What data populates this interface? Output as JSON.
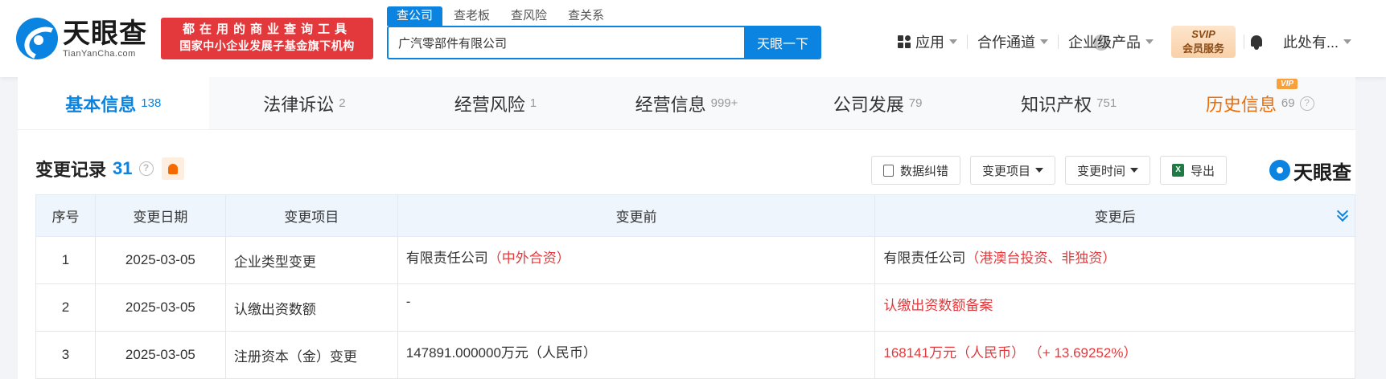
{
  "header": {
    "logo_cn": "天眼查",
    "logo_en": "TianYanCha.com",
    "slogan_line1": "都在用的商业查询工具",
    "slogan_line2": "国家中小企业发展子基金旗下机构",
    "search_tabs": [
      "查公司",
      "查老板",
      "查风险",
      "查关系"
    ],
    "search_value": "广汽零部件有限公司",
    "search_button": "天眼一下",
    "clear_icon": "⊗",
    "nav": [
      "应用",
      "合作通道",
      "企业级产品"
    ],
    "svip_line1": "SVIP",
    "svip_line2": "会员服务",
    "user": "此处有..."
  },
  "tabs": [
    {
      "label": "基本信息",
      "count": "138"
    },
    {
      "label": "法律诉讼",
      "count": "2"
    },
    {
      "label": "经营风险",
      "count": "1"
    },
    {
      "label": "经营信息",
      "count": "999+"
    },
    {
      "label": "公司发展",
      "count": "79"
    },
    {
      "label": "知识产权",
      "count": "751"
    },
    {
      "label": "历史信息",
      "count": "69",
      "badge": "VIP"
    }
  ],
  "section": {
    "title": "变更记录",
    "count": "31",
    "help": "?",
    "toolbar": {
      "correct": "数据纠错",
      "change_item": "变更项目",
      "change_time": "变更时间",
      "export": "导出"
    },
    "brand": "天眼查"
  },
  "table": {
    "headers": [
      "序号",
      "变更日期",
      "变更项目",
      "变更前",
      "变更后"
    ],
    "rows": [
      {
        "no": "1",
        "date": "2025-03-05",
        "item": "企业类型变更",
        "before": "有限责任公司",
        "before_hl": "（中外合资）",
        "after": "有限责任公司",
        "after_hl": "（港澳台投资、非独资）"
      },
      {
        "no": "2",
        "date": "2025-03-05",
        "item": "认缴出资数额",
        "before": "-",
        "before_hl": "",
        "after": "",
        "after_hl": "认缴出资数额备案"
      },
      {
        "no": "3",
        "date": "2025-03-05",
        "item": "注册资本（金）变更",
        "before": "147891.000000万元（人民币）",
        "before_hl": "",
        "after": "",
        "after_hl": "168141万元（人民币）  （+ 13.69252%）"
      }
    ]
  }
}
